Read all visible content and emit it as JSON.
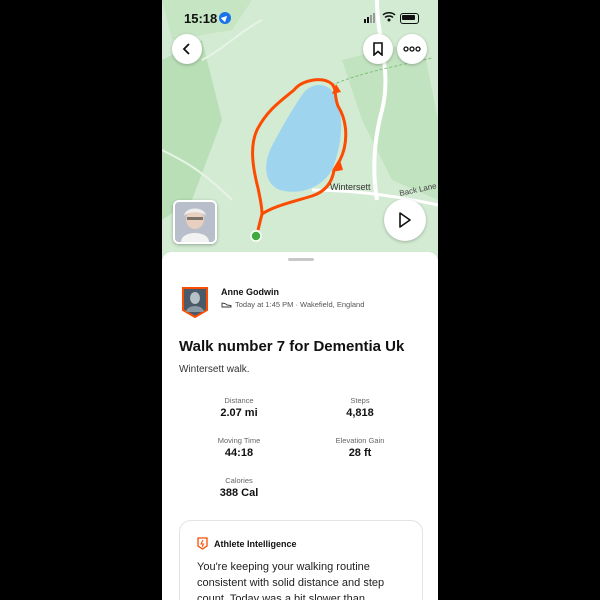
{
  "status": {
    "time": "15:18"
  },
  "map": {
    "labels": {
      "village": "Wintersett",
      "road": "Back Lane"
    }
  },
  "activity": {
    "athlete": "Anne Godwin",
    "meta": "Today at 1:45 PM · Wakefield, England",
    "title": "Walk number 7 for Dementia Uk",
    "description": "Wintersett walk."
  },
  "stats": [
    {
      "label": "Distance",
      "value": "2.07 mi"
    },
    {
      "label": "Steps",
      "value": "4,818"
    },
    {
      "label": "Moving Time",
      "value": "44:18"
    },
    {
      "label": "Elevation Gain",
      "value": "28 ft"
    },
    {
      "label": "Calories",
      "value": "388 Cal"
    }
  ],
  "ai_card": {
    "title": "Athlete Intelligence",
    "text": "You're keeping your walking routine consistent with solid distance and step count. Today was a bit slower than"
  },
  "colors": {
    "route": "#fc4c02",
    "water": "#9fd4ef",
    "map_green": "#cfe9cf",
    "start_dot": "#3dab3d"
  },
  "icons": [
    "back-icon",
    "bookmark-icon",
    "more-icon",
    "play-icon",
    "shoe-icon",
    "athlete-intelligence-icon"
  ]
}
